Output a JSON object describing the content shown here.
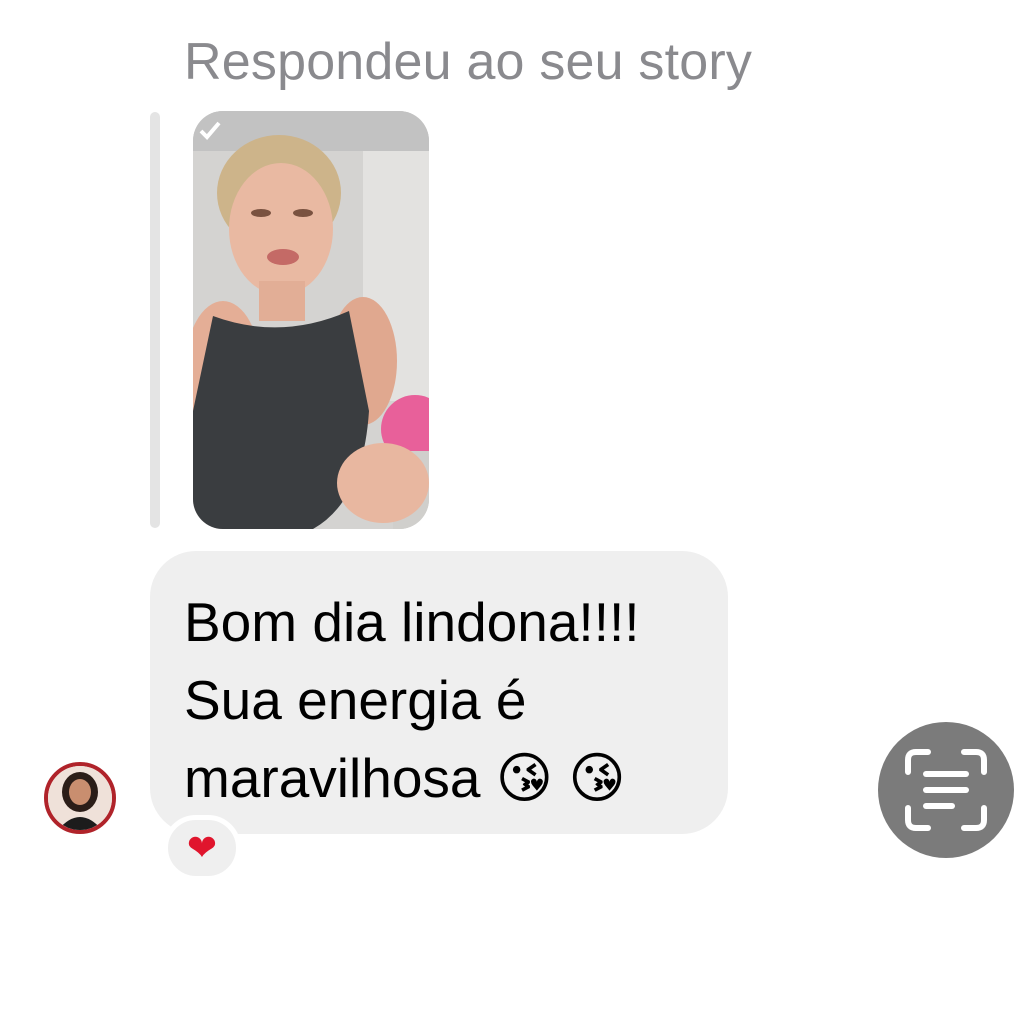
{
  "header": {
    "reply_label": "Respondeu ao seu story"
  },
  "story": {
    "thumbnail_icon": "story-photo"
  },
  "message": {
    "text": "Bom dia lindona!!!!\nSua energia é\nmaravilhosa 😘 😘"
  },
  "reaction": {
    "emoji": "❤"
  },
  "sender": {
    "avatar_icon": "user-avatar"
  },
  "action": {
    "icon": "live-text-scan-icon"
  },
  "colors": {
    "bubble": "#efefef",
    "label": "#8a8a8e",
    "scan_button": "#7b7b7b",
    "heart": "#e0152d",
    "avatar_ring": "#b0232a"
  }
}
